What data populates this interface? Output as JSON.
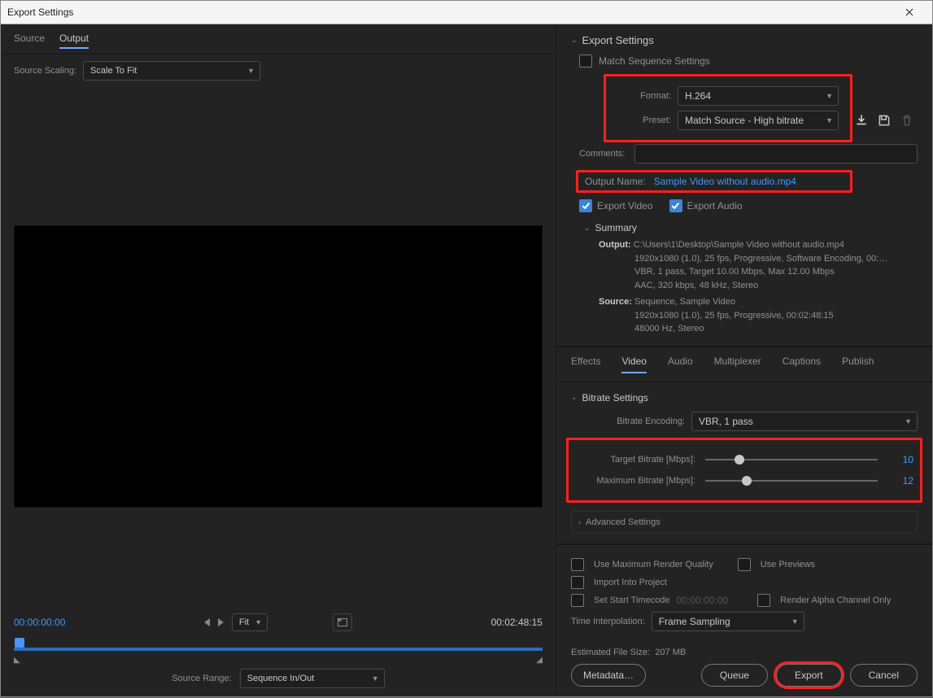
{
  "window": {
    "title": "Export Settings"
  },
  "left": {
    "tabs": {
      "source": "Source",
      "output": "Output"
    },
    "source_scaling_label": "Source Scaling:",
    "source_scaling_value": "Scale To Fit",
    "timecode_start": "00:00:00:00",
    "timecode_end": "00:02:48:15",
    "fit_label": "Fit",
    "source_range_label": "Source Range:",
    "source_range_value": "Sequence In/Out"
  },
  "export": {
    "header": "Export Settings",
    "match_seq": "Match Sequence Settings",
    "format_label": "Format:",
    "format_value": "H.264",
    "preset_label": "Preset:",
    "preset_value": "Match Source - High bitrate",
    "comments_label": "Comments:",
    "output_name_label": "Output Name:",
    "output_name_value": "Sample  Video without audio.mp4",
    "export_video": "Export Video",
    "export_audio": "Export Audio",
    "summary_header": "Summary",
    "output_l": "Output:",
    "output_path": "C:\\Users\\1\\Desktop\\Sample  Video without audio.mp4",
    "output_line2": "1920x1080 (1.0), 25 fps, Progressive, Software Encoding, 00:…",
    "output_line3": "VBR, 1 pass, Target 10.00 Mbps, Max 12.00 Mbps",
    "output_line4": "AAC, 320 kbps, 48 kHz, Stereo",
    "source_l": "Source:",
    "source_line1": "Sequence, Sample Video",
    "source_line2": "1920x1080 (1.0), 25 fps, Progressive, 00:02:48:15",
    "source_line3": "48000 Hz, Stereo"
  },
  "tabs2": {
    "effects": "Effects",
    "video": "Video",
    "audio": "Audio",
    "multiplexer": "Multiplexer",
    "captions": "Captions",
    "publish": "Publish"
  },
  "bitrate": {
    "header": "Bitrate Settings",
    "encoding_label": "Bitrate Encoding:",
    "encoding_value": "VBR, 1 pass",
    "target_label": "Target Bitrate [Mbps]:",
    "target_value": "10",
    "max_label": "Maximum Bitrate [Mbps]:",
    "max_value": "12",
    "advanced": "Advanced Settings"
  },
  "footer": {
    "max_render": "Use Maximum Render Quality",
    "use_previews": "Use Previews",
    "import_project": "Import Into Project",
    "set_start_tc": "Set Start Timecode",
    "start_tc_value": "00:00:00:00",
    "render_alpha": "Render Alpha Channel Only",
    "time_interp_label": "Time Interpolation:",
    "time_interp_value": "Frame Sampling",
    "est_label": "Estimated File Size:",
    "est_value": "207 MB",
    "metadata": "Metadata…",
    "queue": "Queue",
    "export": "Export",
    "cancel": "Cancel"
  }
}
